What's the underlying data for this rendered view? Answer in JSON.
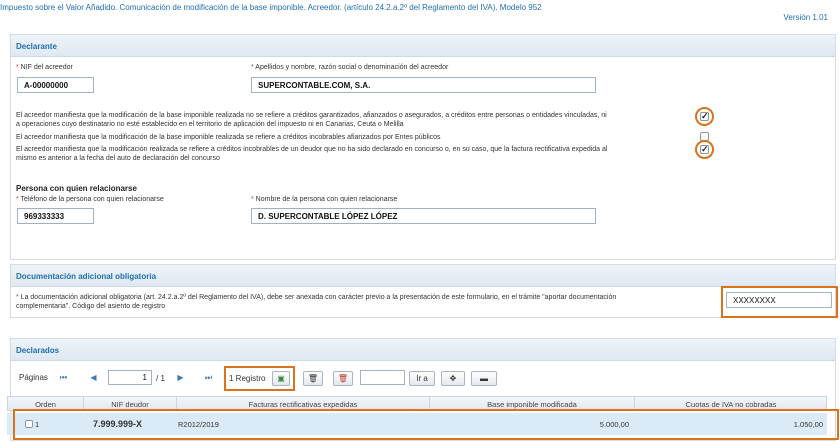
{
  "header": {
    "title": "Impuesto sobre el Valor Añadido. Comunicación de modificación de la base imponible. Acreedor. (artículo 24.2.a.2º del Reglamento del IVA). Modelo 952",
    "version": "Versión 1.01"
  },
  "declarante": {
    "section_title": "Declarante",
    "nif_label": "NIF del acreedor",
    "nif_value": "A-00000000",
    "name_label": "Apellidos y nombre, razón social o denominación del acreedor",
    "name_value": "SUPERCONTABLE.COM, S.A.",
    "statements": [
      {
        "line1": "El acreedor manifiesta que la modificación de la base imponible realizada no se refiere a créditos garantizados, afianzados o asegurados, a créditos entre personas o entidades vinculadas, ni",
        "line2": "a operaciones cuyo destinatario no esté establecido en el territorio de aplicación del impuesto ni en Canarias, Ceuta o Melilla",
        "checked": true
      },
      {
        "line1": "El acreedor manifiesta que la modificación de la base imponible realizada se refiere a créditos incobrables afianzados por Entes públicos",
        "line2": "",
        "checked": false
      },
      {
        "line1": "El acreedor manifiesta que la modificación realizada se refiere a créditos incobrables de un deudor que no ha sido declarado en concurso o, en su caso, que la factura rectificativa expedida al",
        "line2": "mismo es anterior a la fecha del auto de declaración del concurso",
        "checked": true
      }
    ],
    "contact_heading": "Persona con quien relacionarse",
    "phone_label": "Teléfono de la persona con quien relacionarse",
    "phone_value": "969333333",
    "contact_name_label": "Nombre de la persona con quien relacionarse",
    "contact_name_value": "D. SUPERCONTABLE LÓPEZ LÓPEZ"
  },
  "documentacion": {
    "section_title": "Documentación adicional obligatoria",
    "text_line1": "La documentación adicional obligatoria (art. 24.2.a.2º del Reglamento del IVA), debe ser anexada con carácter previo a la presentación de este formulario, en el trámite \"aportar documentación",
    "text_line2": "complementaria\". Código del asiento de registro",
    "code_value": "XXXXXXXX"
  },
  "declarados": {
    "section_title": "Declarados",
    "pager": {
      "pages_label": "Páginas",
      "current_page": "1",
      "total_pages": "/ 1",
      "records": "1 Registro",
      "goto_label": "Ir a"
    },
    "columns": [
      "Orden",
      "NIF deudor",
      "Facturas rectificativas expedidas",
      "Base imponible modificada",
      "Cuotas de IVA no cobradas"
    ],
    "rows": [
      {
        "orden": "1",
        "nif": "7.999.999-X",
        "facturas": "R2012/2019",
        "base": "5.000,00",
        "cuotas": "1.050,00"
      }
    ]
  },
  "colors": {
    "accent": "#1f6fae",
    "highlight": "#d9731c",
    "row_selected": "#dbeaf7"
  }
}
